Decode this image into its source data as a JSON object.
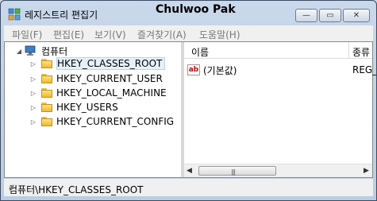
{
  "window": {
    "app_title": "레지스트리 편집기",
    "user_title": "Chulwoo Pak",
    "minimize_glyph": "—",
    "maximize_glyph": "▭",
    "close_glyph": "✕"
  },
  "menu": [
    "파일(F)",
    "편집(E)",
    "보기(V)",
    "즐겨찾기(A)",
    "도움말(H)"
  ],
  "tree": {
    "root_label": "컴퓨터",
    "items": [
      "HKEY_CLASSES_ROOT",
      "HKEY_CURRENT_USER",
      "HKEY_LOCAL_MACHINE",
      "HKEY_USERS",
      "HKEY_CURRENT_CONFIG"
    ]
  },
  "list": {
    "col_name": "이름",
    "col_type": "종류",
    "rows": [
      {
        "name": "(기본값)",
        "type": "REG_"
      }
    ],
    "value_icon_text": "ab"
  },
  "status": "컴퓨터\\HKEY_CLASSES_ROOT"
}
